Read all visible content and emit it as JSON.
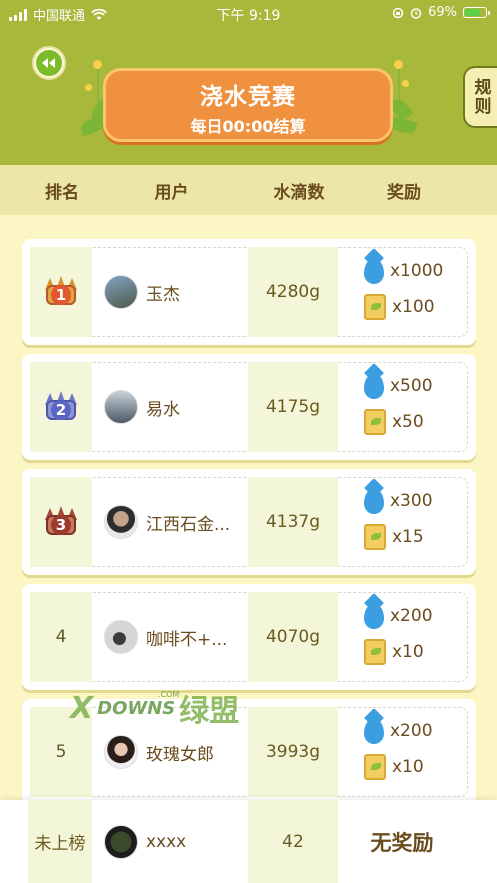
{
  "status_bar": {
    "carrier": "中国联通",
    "time": "下午 9:19",
    "battery": "69%",
    "battery_level": 0.69
  },
  "banner": {
    "title": "浇水竞赛",
    "subtitle": "每日00:00结算"
  },
  "rules_label": "规则",
  "columns": [
    "排名",
    "用户",
    "水滴数",
    "奖励"
  ],
  "rows": [
    {
      "rank": "1",
      "name": "玉杰",
      "drops": "4280g",
      "water_reward": "x1000",
      "seed_reward": "x100",
      "avatar": "avatar-photo"
    },
    {
      "rank": "2",
      "name": "易水",
      "drops": "4175g",
      "water_reward": "x500",
      "seed_reward": "x50",
      "avatar": "avatar-photo"
    },
    {
      "rank": "3",
      "name": "江西石金...",
      "drops": "4137g",
      "water_reward": "x300",
      "seed_reward": "x15",
      "avatar": "avatar-photo"
    },
    {
      "rank": "4",
      "name": "咖啡不+...",
      "drops": "4070g",
      "water_reward": "x200",
      "seed_reward": "x10",
      "avatar": "avatar-photo"
    },
    {
      "rank": "5",
      "name": "玫瑰女郎",
      "drops": "3993g",
      "water_reward": "x200",
      "seed_reward": "x10",
      "avatar": "avatar-photo"
    }
  ],
  "footer": {
    "rank": "未上榜",
    "name": "xxxx",
    "drops": "42",
    "reward": "无奖励"
  },
  "watermark": {
    "mark": "X",
    "latin": "DOWNS",
    "com": ".COM",
    "cn": "绿盟"
  },
  "colors": {
    "top_bg": "#a8b83a",
    "banner": "#f0913f",
    "page_bg": "#fbf6c3",
    "gold_crown": "#d9912e",
    "silver_crown": "#6f79c8",
    "bronze_crown": "#a5493a"
  }
}
